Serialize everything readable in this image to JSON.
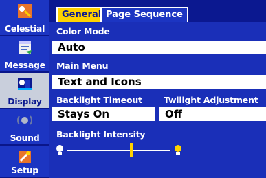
{
  "sidebar": {
    "items": [
      {
        "label": "Celestial",
        "icon": "celestial-icon"
      },
      {
        "label": "Message",
        "icon": "message-icon"
      },
      {
        "label": "Display",
        "icon": "display-icon",
        "active": true
      },
      {
        "label": "Sound",
        "icon": "sound-icon"
      },
      {
        "label": "Setup",
        "icon": "setup-icon"
      }
    ]
  },
  "tabs": [
    {
      "label": "General",
      "active": true
    },
    {
      "label": "Page Sequence",
      "active": false
    }
  ],
  "settings": {
    "color_mode": {
      "label": "Color Mode",
      "value": "Auto"
    },
    "main_menu": {
      "label": "Main Menu",
      "value": "Text and Icons"
    },
    "backlight_timeout": {
      "label": "Backlight Timeout",
      "value": "Stays On"
    },
    "twilight_adjustment": {
      "label": "Twilight Adjustment",
      "value": "Off"
    },
    "backlight_intensity": {
      "label": "Backlight Intensity",
      "level_fraction": 0.62
    }
  },
  "colors": {
    "background": "#1a2fb8",
    "sidebar": "#0b1890",
    "accent": "#ffd200",
    "field": "#ffffff"
  }
}
